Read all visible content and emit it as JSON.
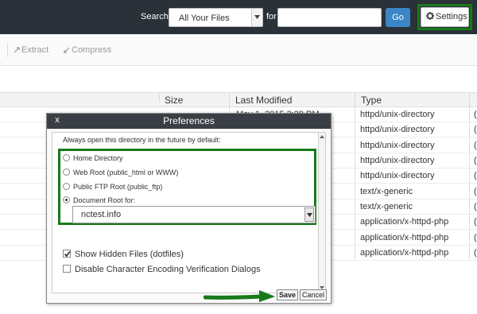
{
  "header": {
    "search_label": "Search",
    "search_scope": "All Your Files",
    "for_label": "for",
    "search_value": "",
    "go_label": "Go",
    "settings_label": "Settings"
  },
  "toolbar": {
    "extract_label": "Extract",
    "compress_label": "Compress"
  },
  "table": {
    "columns": [
      "Size",
      "Last Modified",
      "Type"
    ],
    "first_row_modified": "May 1, 2015 3:29 PM",
    "rows": [
      {
        "type": "httpd/unix-directory",
        "cut": "("
      },
      {
        "type": "httpd/unix-directory",
        "cut": "("
      },
      {
        "type": "httpd/unix-directory",
        "cut": "("
      },
      {
        "type": "httpd/unix-directory",
        "cut": "("
      },
      {
        "type": "httpd/unix-directory",
        "cut": "("
      },
      {
        "type": "text/x-generic",
        "cut": "("
      },
      {
        "type": "text/x-generic",
        "cut": "("
      },
      {
        "type": "application/x-httpd-php",
        "cut": "("
      },
      {
        "type": "application/x-httpd-php",
        "cut": "("
      },
      {
        "type": "application/x-httpd-php",
        "cut": "("
      }
    ]
  },
  "dialog": {
    "title": "Preferences",
    "close_label": "x",
    "instruction": "Always open this directory in the future by default:",
    "options": [
      {
        "label": "Home Directory",
        "selected": false
      },
      {
        "label": "Web Root (public_html or WWW)",
        "selected": false
      },
      {
        "label": "Public FTP Root (public_ftp)",
        "selected": false
      },
      {
        "label": "Document Root for:",
        "selected": true
      }
    ],
    "document_root_value": "nctest.info",
    "show_hidden_label": "Show Hidden Files (dotfiles)",
    "show_hidden_checked": true,
    "disable_encoding_label": "Disable Character Encoding Verification Dialogs",
    "disable_encoding_checked": false,
    "save_label": "Save",
    "cancel_label": "Cancel"
  },
  "colors": {
    "topbar": "#2b3138",
    "highlight_green": "#167a1a",
    "go_blue": "#3a86c8"
  }
}
